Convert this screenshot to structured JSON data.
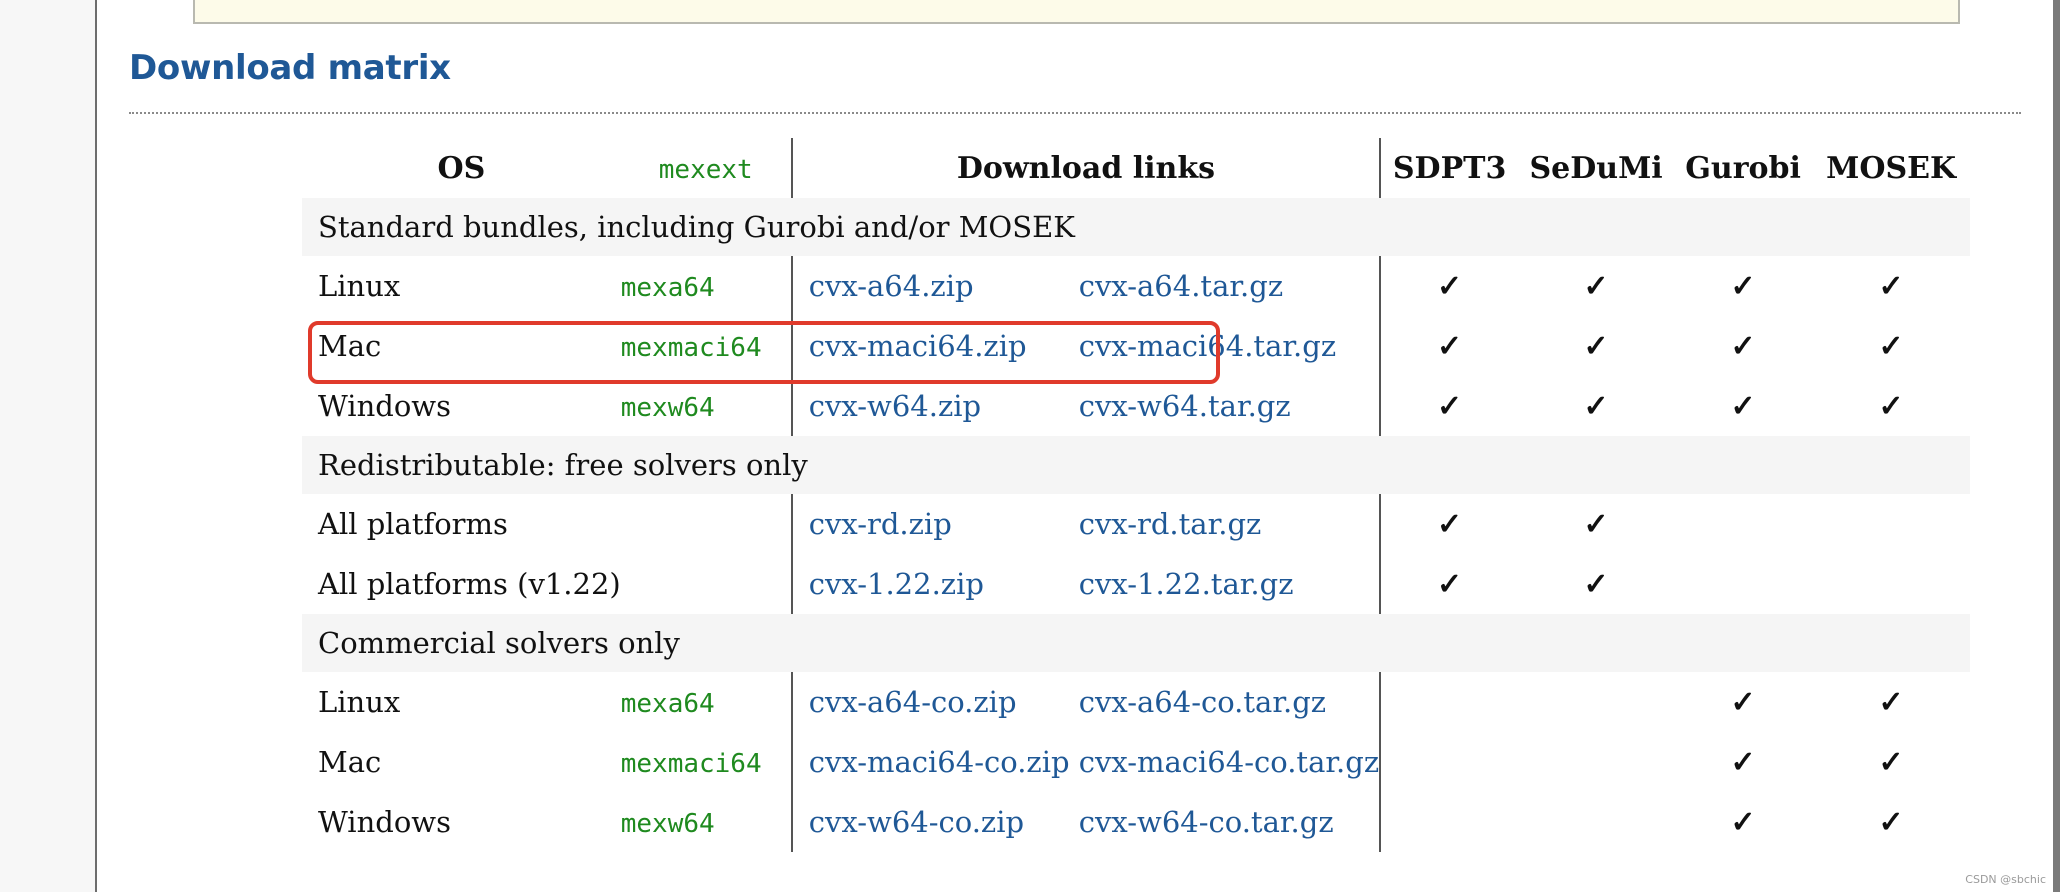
{
  "section_title": "Download matrix",
  "headers": {
    "os": "OS",
    "mexext": "mexext",
    "links": "Download links",
    "solvers": [
      "SDPT3",
      "SeDuMi",
      "Gurobi",
      "MOSEK"
    ]
  },
  "check_glyph": "✓",
  "sections": [
    {
      "title": "Standard bundles, including Gurobi and/or MOSEK",
      "rows": [
        {
          "os": "Linux",
          "ext": "mexa64",
          "zip": "cvx-a64.zip",
          "tgz": "cvx-a64.tar.gz",
          "solvers": [
            true,
            true,
            true,
            true
          ],
          "highlighted": false
        },
        {
          "os": "Mac",
          "ext": "mexmaci64",
          "zip": "cvx-maci64.zip",
          "tgz": "cvx-maci64.tar.gz",
          "solvers": [
            true,
            true,
            true,
            true
          ],
          "highlighted": true
        },
        {
          "os": "Windows",
          "ext": "mexw64",
          "zip": "cvx-w64.zip",
          "tgz": "cvx-w64.tar.gz",
          "solvers": [
            true,
            true,
            true,
            true
          ],
          "highlighted": false
        }
      ]
    },
    {
      "title": "Redistributable: free solvers only",
      "rows": [
        {
          "os": "All platforms",
          "ext": "",
          "zip": "cvx-rd.zip",
          "tgz": "cvx-rd.tar.gz",
          "solvers": [
            true,
            true,
            false,
            false
          ],
          "highlighted": false
        },
        {
          "os": "All platforms (v1.22)",
          "ext": "",
          "zip": "cvx-1.22.zip",
          "tgz": "cvx-1.22.tar.gz",
          "solvers": [
            true,
            true,
            false,
            false
          ],
          "highlighted": false
        }
      ]
    },
    {
      "title": "Commercial solvers only",
      "rows": [
        {
          "os": "Linux",
          "ext": "mexa64",
          "zip": "cvx-a64-co.zip",
          "tgz": "cvx-a64-co.tar.gz",
          "solvers": [
            false,
            false,
            true,
            true
          ],
          "highlighted": false
        },
        {
          "os": "Mac",
          "ext": "mexmaci64",
          "zip": "cvx-maci64-co.zip",
          "tgz": "cvx-maci64-co.tar.gz",
          "solvers": [
            false,
            false,
            true,
            true
          ],
          "highlighted": false
        },
        {
          "os": "Windows",
          "ext": "mexw64",
          "zip": "cvx-w64-co.zip",
          "tgz": "cvx-w64-co.tar.gz",
          "solvers": [
            false,
            false,
            true,
            true
          ],
          "highlighted": false
        }
      ]
    }
  ],
  "colors": {
    "title": "#1f5896",
    "link": "#1f5896",
    "mexext": "#1f8a1f",
    "highlight_border": "#e03a2b",
    "section_bg": "#f5f5f5"
  },
  "watermark": "CSDN @sbchic"
}
